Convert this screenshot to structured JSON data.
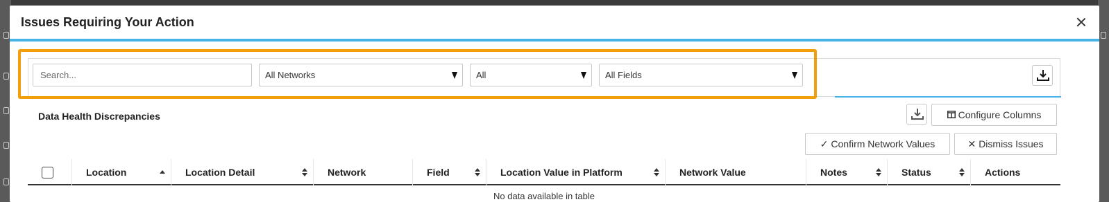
{
  "modal": {
    "title": "Issues Requiring Your Action",
    "close_icon": "close-icon"
  },
  "filters": {
    "search_placeholder": "Search...",
    "network_select": "All Networks",
    "status_select": "All",
    "fields_select": "All Fields",
    "export_icon": "download-icon"
  },
  "section": {
    "title": "Data Health Discrepancies",
    "download_icon": "download-icon",
    "configure_columns_label": "Configure Columns",
    "confirm_label": "Confirm Network Values",
    "dismiss_label": "Dismiss Issues"
  },
  "table": {
    "columns": [
      "Location",
      "Location Detail",
      "Network",
      "Field",
      "Location Value in Platform",
      "Network Value",
      "Notes",
      "Status",
      "Actions"
    ],
    "empty_message": "No data available in table"
  },
  "colors": {
    "accent": "#45b3e6",
    "highlight": "#f59e0b"
  }
}
